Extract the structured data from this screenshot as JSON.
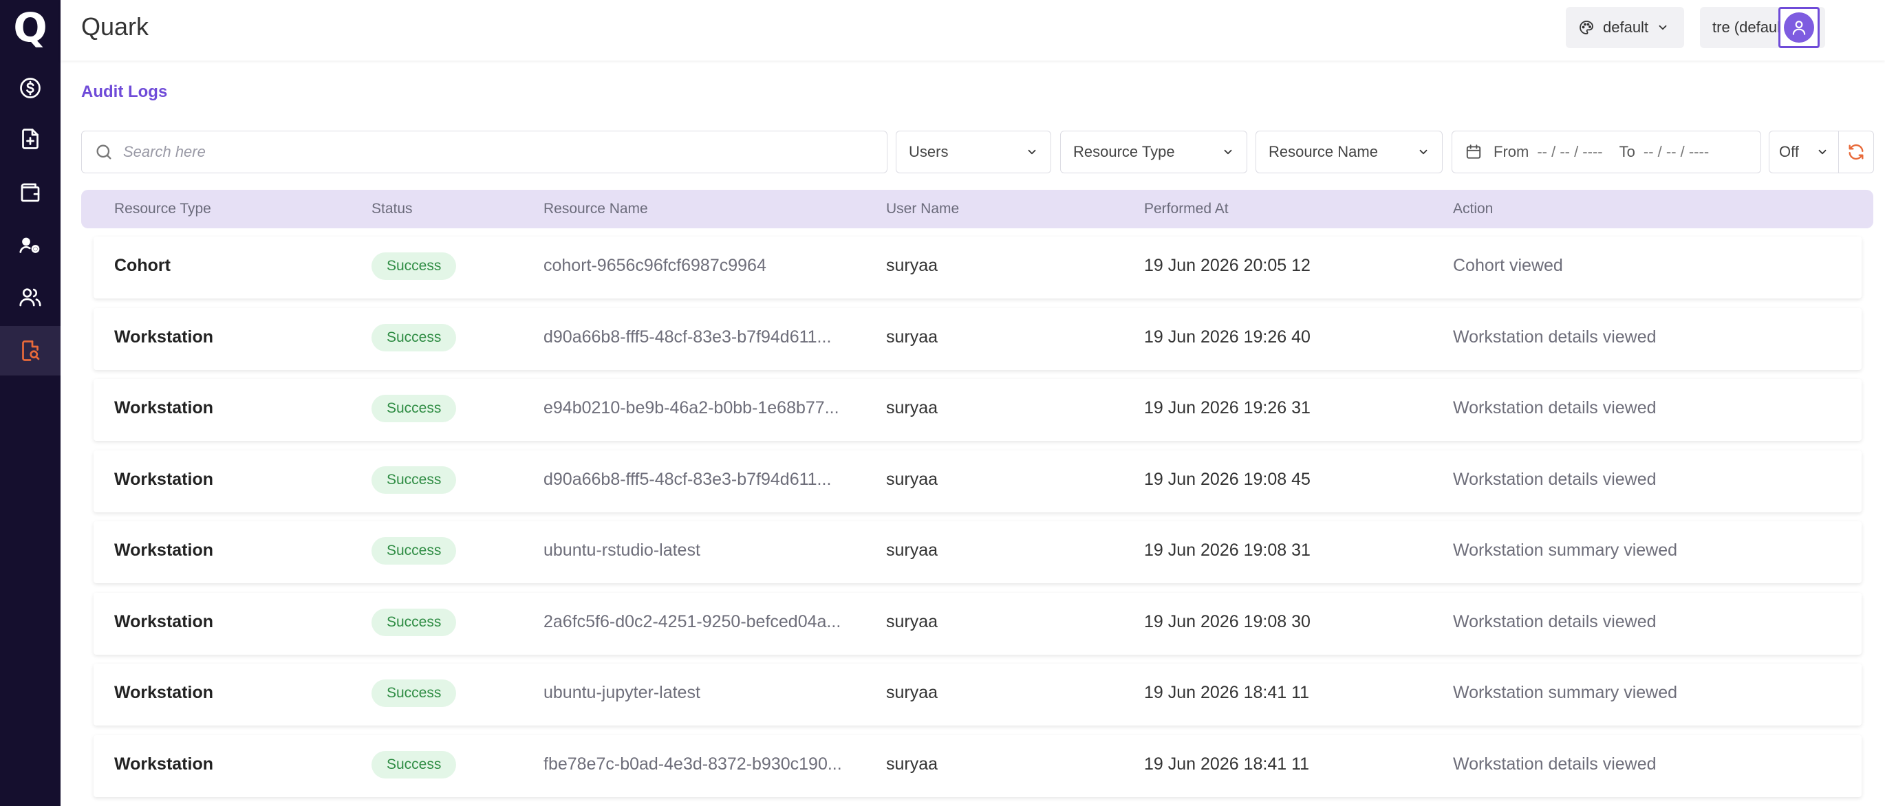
{
  "app": {
    "title": "Quark",
    "logo": "Q"
  },
  "header": {
    "theme_label": "default",
    "workspace_label": "tre (default)"
  },
  "breadcrumb": "Audit Logs",
  "filters": {
    "search_placeholder": "Search here",
    "users_label": "Users",
    "resource_type_label": "Resource Type",
    "resource_name_label": "Resource Name",
    "from_label": "From",
    "from_value": "-- / -- / ----",
    "to_label": "To",
    "to_value": "-- / -- / ----",
    "refresh_interval": "Off"
  },
  "columns": [
    "Resource Type",
    "Status",
    "Resource Name",
    "User Name",
    "Performed At",
    "Action"
  ],
  "rows": [
    {
      "type": "Cohort",
      "status": "Success",
      "name": "cohort-9656c96fcf6987c9964",
      "user": "suryaa",
      "time": "19 Jun 2026 20:05 12",
      "action": "Cohort viewed"
    },
    {
      "type": "Workstation",
      "status": "Success",
      "name": "d90a66b8-fff5-48cf-83e3-b7f94d611...",
      "user": "suryaa",
      "time": "19 Jun 2026 19:26 40",
      "action": "Workstation details viewed"
    },
    {
      "type": "Workstation",
      "status": "Success",
      "name": "e94b0210-be9b-46a2-b0bb-1e68b77...",
      "user": "suryaa",
      "time": "19 Jun 2026 19:26 31",
      "action": "Workstation details viewed"
    },
    {
      "type": "Workstation",
      "status": "Success",
      "name": "d90a66b8-fff5-48cf-83e3-b7f94d611...",
      "user": "suryaa",
      "time": "19 Jun 2026 19:08 45",
      "action": "Workstation details viewed"
    },
    {
      "type": "Workstation",
      "status": "Success",
      "name": "ubuntu-rstudio-latest",
      "user": "suryaa",
      "time": "19 Jun 2026 19:08 31",
      "action": "Workstation summary viewed"
    },
    {
      "type": "Workstation",
      "status": "Success",
      "name": "2a6fc5f6-d0c2-4251-9250-befced04a...",
      "user": "suryaa",
      "time": "19 Jun 2026 19:08 30",
      "action": "Workstation details viewed"
    },
    {
      "type": "Workstation",
      "status": "Success",
      "name": "ubuntu-jupyter-latest",
      "user": "suryaa",
      "time": "19 Jun 2026 18:41 11",
      "action": "Workstation summary viewed"
    },
    {
      "type": "Workstation",
      "status": "Success",
      "name": "fbe78e7c-b0ad-4e3d-8372-b930c190...",
      "user": "suryaa",
      "time": "19 Jun 2026 18:41 11",
      "action": "Workstation details viewed"
    }
  ],
  "colors": {
    "sidebar_bg": "#150f2e",
    "accent": "#6f4bd8",
    "active_nav_icon": "#e86a3a",
    "success_bg": "#e3f6e7",
    "success_text": "#2e8c43",
    "table_header_bg": "#e6e0f5"
  },
  "icons": {
    "nav": [
      "dollar-circle-icon",
      "file-plus-icon",
      "wallet-icon",
      "user-gear-icon",
      "users-icon",
      "file-search-icon"
    ],
    "theme": "palette-icon",
    "date": "calendar-icon",
    "refresh": "refresh-icon",
    "search": "search-icon",
    "profile": "user-icon"
  }
}
